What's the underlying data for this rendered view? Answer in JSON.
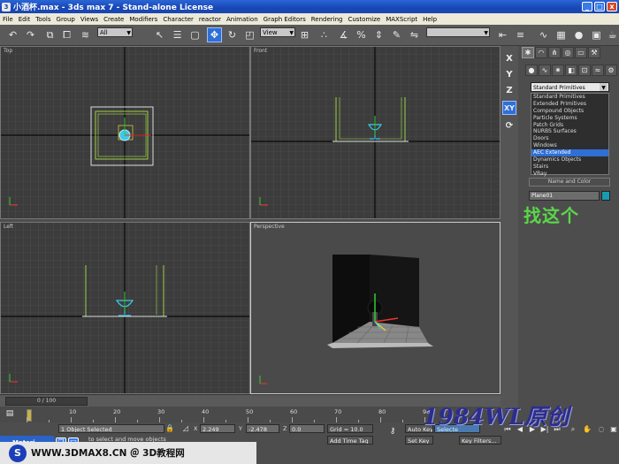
{
  "window": {
    "title": "小酒杯.max - 3ds max 7 - Stand-alone License",
    "min": "_",
    "max": "□",
    "close": "x"
  },
  "menu": [
    "File",
    "Edit",
    "Tools",
    "Group",
    "Views",
    "Create",
    "Modifiers",
    "Character",
    "reactor",
    "Animation",
    "Graph Editors",
    "Rendering",
    "Customize",
    "MAXScript",
    "Help"
  ],
  "toolbar": {
    "selection_filter": "All",
    "ref_coord": "View"
  },
  "viewports": {
    "top": "Top",
    "front": "Front",
    "left": "Left",
    "perspective": "Perspective"
  },
  "axis_constraints": [
    "X",
    "Y",
    "Z",
    "XY"
  ],
  "command_panel": {
    "dropdown_value": "Standard Primitives",
    "list_items": [
      "Standard Primitives",
      "Extended Primitives",
      "Compound Objects",
      "Particle Systems",
      "Patch Grids",
      "NURBS Surfaces",
      "Doors",
      "Windows",
      "AEC Extended",
      "Dynamics Objects",
      "Stairs",
      "VRay"
    ],
    "selected_item": "AEC Extended",
    "rollout_label": "Name and Color",
    "object_name": "Plane01",
    "swatch_color": "#1a9ab0"
  },
  "annotation": "找这个",
  "timeline": {
    "frame": "0 / 100",
    "ticks": [
      "10",
      "20",
      "30",
      "40",
      "50",
      "60",
      "70",
      "80",
      "90"
    ]
  },
  "status": {
    "selected": "1 Object Selected",
    "hint": "to select and move objects",
    "x_label": "X",
    "x_value": "2.249",
    "y_label": "Y",
    "y_value": "-2.478",
    "z_label": "Z",
    "z_value": "0.0",
    "grid": "Grid = 10.0",
    "add_time_tag": "Add Time Tag",
    "auto_key": "Auto Key",
    "set_key": "Set Key",
    "selected_filter": "Selecte",
    "key_filters": "Key Filters..."
  },
  "watermark": "1984WL原创",
  "taskbar_item": "Materi",
  "banner": "WWW.3DMAX8.CN ＠ 3D教程网"
}
